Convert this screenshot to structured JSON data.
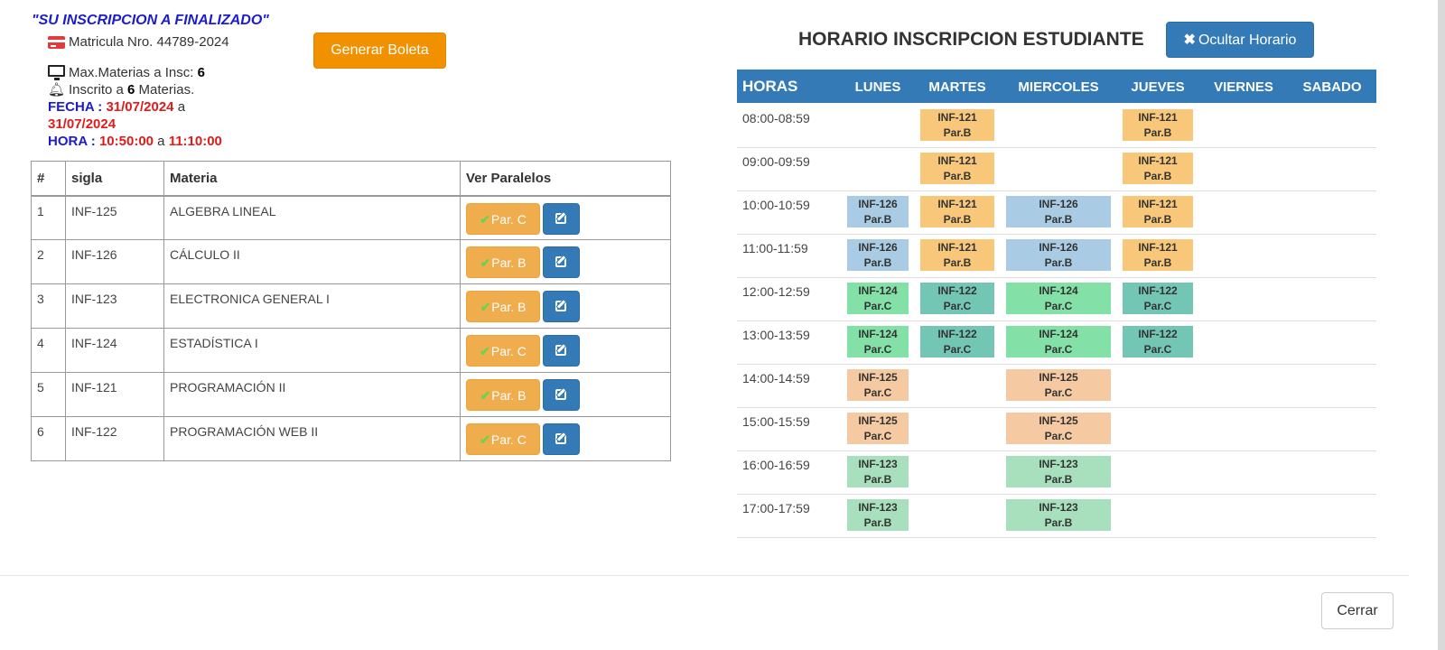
{
  "status": {
    "title": "\"SU INSCRIPCION A FINALIZADO\"",
    "matricula_label": "Matricula Nro.",
    "matricula_value": "44789-2024",
    "max_label": "Max.Materias a Insc:",
    "max_value": "6",
    "inscrito_prefix": "Inscrito a",
    "inscrito_value": "6",
    "inscrito_suffix": "Materias.",
    "fecha_label": "FECHA :",
    "fecha_inicio": "31/07/2024",
    "fecha_sep": "a",
    "fecha_fin": "31/07/2024",
    "hora_label": "HORA :",
    "hora_inicio": "10:50:00",
    "hora_sep": "a",
    "hora_fin": "11:10:00"
  },
  "actions": {
    "generar_boleta": "Generar Boleta",
    "ocultar_horario": "Ocultar Horario",
    "cerrar": "Cerrar"
  },
  "materias_table": {
    "headers": [
      "#",
      "sigla",
      "Materia",
      "Ver Paralelos"
    ],
    "rows": [
      {
        "num": "1",
        "sigla": "INF-125",
        "materia": "ALGEBRA LINEAL",
        "paralelo": "Par. C"
      },
      {
        "num": "2",
        "sigla": "INF-126",
        "materia": "CÁLCULO II",
        "paralelo": "Par. B"
      },
      {
        "num": "3",
        "sigla": "INF-123",
        "materia": "ELECTRONICA GENERAL I",
        "paralelo": "Par. B"
      },
      {
        "num": "4",
        "sigla": "INF-124",
        "materia": "ESTADÍSTICA I",
        "paralelo": "Par. C"
      },
      {
        "num": "5",
        "sigla": "INF-121",
        "materia": "PROGRAMACIÓN II",
        "paralelo": "Par. B"
      },
      {
        "num": "6",
        "sigla": "INF-122",
        "materia": "PROGRAMACIÓN WEB II",
        "paralelo": "Par. C"
      }
    ]
  },
  "schedule": {
    "title": "HORARIO INSCRIPCION ESTUDIANTE",
    "header_horas": "HORAS",
    "days": [
      "LUNES",
      "MARTES",
      "MIERCOLES",
      "JUEVES",
      "VIERNES",
      "SABADO"
    ],
    "rows": [
      {
        "time": "08:00-08:59",
        "cells": [
          null,
          {
            "code": "INF-121",
            "par": "Par.B"
          },
          null,
          {
            "code": "INF-121",
            "par": "Par.B"
          },
          null,
          null
        ]
      },
      {
        "time": "09:00-09:59",
        "cells": [
          null,
          {
            "code": "INF-121",
            "par": "Par.B"
          },
          null,
          {
            "code": "INF-121",
            "par": "Par.B"
          },
          null,
          null
        ]
      },
      {
        "time": "10:00-10:59",
        "cells": [
          {
            "code": "INF-126",
            "par": "Par.B"
          },
          {
            "code": "INF-121",
            "par": "Par.B"
          },
          {
            "code": "INF-126",
            "par": "Par.B"
          },
          {
            "code": "INF-121",
            "par": "Par.B"
          },
          null,
          null
        ]
      },
      {
        "time": "11:00-11:59",
        "cells": [
          {
            "code": "INF-126",
            "par": "Par.B"
          },
          {
            "code": "INF-121",
            "par": "Par.B"
          },
          {
            "code": "INF-126",
            "par": "Par.B"
          },
          {
            "code": "INF-121",
            "par": "Par.B"
          },
          null,
          null
        ]
      },
      {
        "time": "12:00-12:59",
        "cells": [
          {
            "code": "INF-124",
            "par": "Par.C"
          },
          {
            "code": "INF-122",
            "par": "Par.C"
          },
          {
            "code": "INF-124",
            "par": "Par.C"
          },
          {
            "code": "INF-122",
            "par": "Par.C"
          },
          null,
          null
        ]
      },
      {
        "time": "13:00-13:59",
        "cells": [
          {
            "code": "INF-124",
            "par": "Par.C"
          },
          {
            "code": "INF-122",
            "par": "Par.C"
          },
          {
            "code": "INF-124",
            "par": "Par.C"
          },
          {
            "code": "INF-122",
            "par": "Par.C"
          },
          null,
          null
        ]
      },
      {
        "time": "14:00-14:59",
        "cells": [
          {
            "code": "INF-125",
            "par": "Par.C"
          },
          null,
          {
            "code": "INF-125",
            "par": "Par.C"
          },
          null,
          null,
          null
        ]
      },
      {
        "time": "15:00-15:59",
        "cells": [
          {
            "code": "INF-125",
            "par": "Par.C"
          },
          null,
          {
            "code": "INF-125",
            "par": "Par.C"
          },
          null,
          null,
          null
        ]
      },
      {
        "time": "16:00-16:59",
        "cells": [
          {
            "code": "INF-123",
            "par": "Par.B"
          },
          null,
          {
            "code": "INF-123",
            "par": "Par.B"
          },
          null,
          null,
          null
        ]
      },
      {
        "time": "17:00-17:59",
        "cells": [
          {
            "code": "INF-123",
            "par": "Par.B"
          },
          null,
          {
            "code": "INF-123",
            "par": "Par.B"
          },
          null,
          null,
          null
        ]
      }
    ],
    "course_colors": {
      "INF-121": "#f8c77a",
      "INF-126": "#a9cce4",
      "INF-124": "#83e0a6",
      "INF-122": "#74c6b4",
      "INF-125": "#f5caa3",
      "INF-123": "#a8e0bd"
    }
  },
  "icons": {
    "matricula": "credit-card-icon",
    "max_materias": "monitor-icon",
    "inscrito": "bell-icon",
    "paralelo_check": "check-icon",
    "edit": "edit-icon",
    "ocultar": "times-icon"
  }
}
